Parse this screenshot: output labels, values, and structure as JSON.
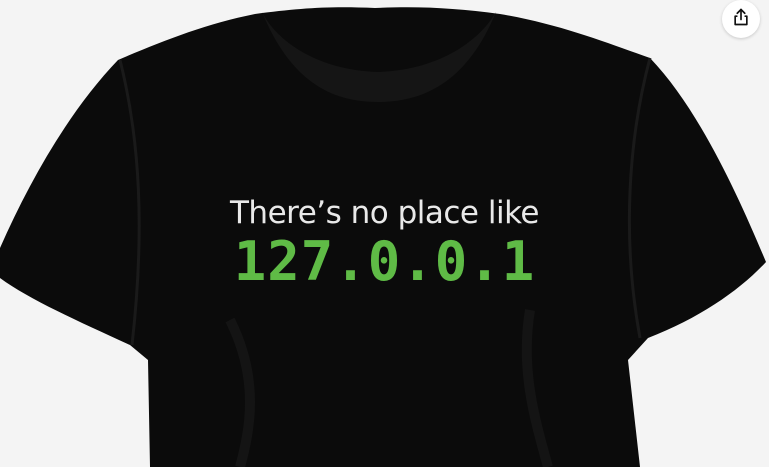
{
  "product": {
    "shirt_color": "#0b0b0b",
    "background_color": "#f4f4f4",
    "print": {
      "line1": "There’s no place like",
      "line2": "127.0.0.1",
      "line1_color": "#e9e9e9",
      "line2_color": "#5fbb46"
    }
  },
  "actions": {
    "share_icon": "share-icon"
  }
}
